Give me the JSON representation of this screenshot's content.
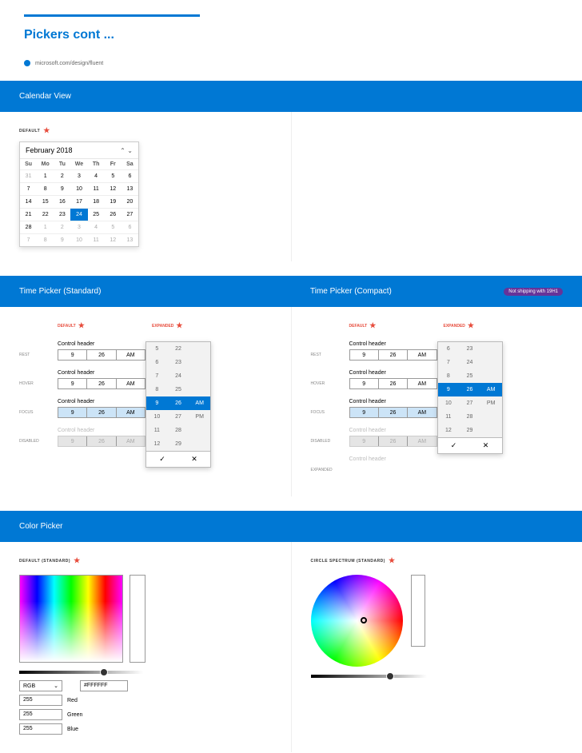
{
  "page": {
    "title": "Pickers cont ...",
    "link": "microsoft.com/design/fluent"
  },
  "sections": {
    "calendar": "Calendar View",
    "timeStandard": "Time Picker (Standard)",
    "timeCompact": "Time Picker (Compact)",
    "color": "Color Picker"
  },
  "badge": "Not shipping with 19H1",
  "labels": {
    "default": "DEFAULT",
    "expanded": "EXPANDED",
    "defaultStandard": "DEFAULT (STANDARD)",
    "circle": "CIRCLE SPECTRUM (STANDARD)"
  },
  "states": {
    "rest": "REST",
    "hover": "HOVER",
    "focus": "FOCUS",
    "disabled": "DISABLED",
    "expanded": "EXPANDED"
  },
  "calendar": {
    "month": "February 2018",
    "dow": [
      "Su",
      "Mo",
      "Tu",
      "We",
      "Th",
      "Fr",
      "Sa"
    ],
    "weeks": [
      [
        {
          "d": 31,
          "m": 1
        },
        {
          "d": 1
        },
        {
          "d": 2
        },
        {
          "d": 3
        },
        {
          "d": 4
        },
        {
          "d": 5
        },
        {
          "d": 6
        }
      ],
      [
        {
          "d": 7
        },
        {
          "d": 8
        },
        {
          "d": 9
        },
        {
          "d": 10
        },
        {
          "d": 11
        },
        {
          "d": 12
        },
        {
          "d": 13
        }
      ],
      [
        {
          "d": 14
        },
        {
          "d": 15
        },
        {
          "d": 16
        },
        {
          "d": 17
        },
        {
          "d": 18
        },
        {
          "d": 19
        },
        {
          "d": 20
        }
      ],
      [
        {
          "d": 21
        },
        {
          "d": 22
        },
        {
          "d": 23
        },
        {
          "d": 24,
          "s": 1
        },
        {
          "d": 25
        },
        {
          "d": 26
        },
        {
          "d": 27
        }
      ],
      [
        {
          "d": 28
        },
        {
          "d": 1,
          "m": 1
        },
        {
          "d": 2,
          "m": 1
        },
        {
          "d": 3,
          "m": 1
        },
        {
          "d": 4,
          "m": 1
        },
        {
          "d": 5,
          "m": 1
        },
        {
          "d": 6,
          "m": 1
        }
      ],
      [
        {
          "d": 7,
          "m": 1
        },
        {
          "d": 8,
          "m": 1
        },
        {
          "d": 9,
          "m": 1
        },
        {
          "d": 10,
          "m": 1
        },
        {
          "d": 11,
          "m": 1
        },
        {
          "d": 12,
          "m": 1
        },
        {
          "d": 13,
          "m": 1
        }
      ]
    ]
  },
  "timePicker": {
    "header": "Control header",
    "value": {
      "hour": "9",
      "minute": "26",
      "period": "AM"
    },
    "standardPopup": [
      [
        "5",
        "22",
        ""
      ],
      [
        "6",
        "23",
        ""
      ],
      [
        "7",
        "24",
        ""
      ],
      [
        "8",
        "25",
        ""
      ],
      [
        "9",
        "26",
        "AM"
      ],
      [
        "10",
        "27",
        "PM"
      ],
      [
        "11",
        "28",
        ""
      ],
      [
        "12",
        "29",
        ""
      ]
    ],
    "compactPopup": [
      [
        "6",
        "23",
        ""
      ],
      [
        "7",
        "24",
        ""
      ],
      [
        "8",
        "25",
        ""
      ],
      [
        "9",
        "26",
        "AM"
      ],
      [
        "10",
        "27",
        "PM"
      ],
      [
        "11",
        "28",
        ""
      ],
      [
        "12",
        "29",
        ""
      ]
    ]
  },
  "colorPicker": {
    "mode": "RGB",
    "hex": "#FFFFFF",
    "channels": [
      {
        "v": "255",
        "l": "Red"
      },
      {
        "v": "255",
        "l": "Green"
      },
      {
        "v": "255",
        "l": "Blue"
      }
    ]
  }
}
